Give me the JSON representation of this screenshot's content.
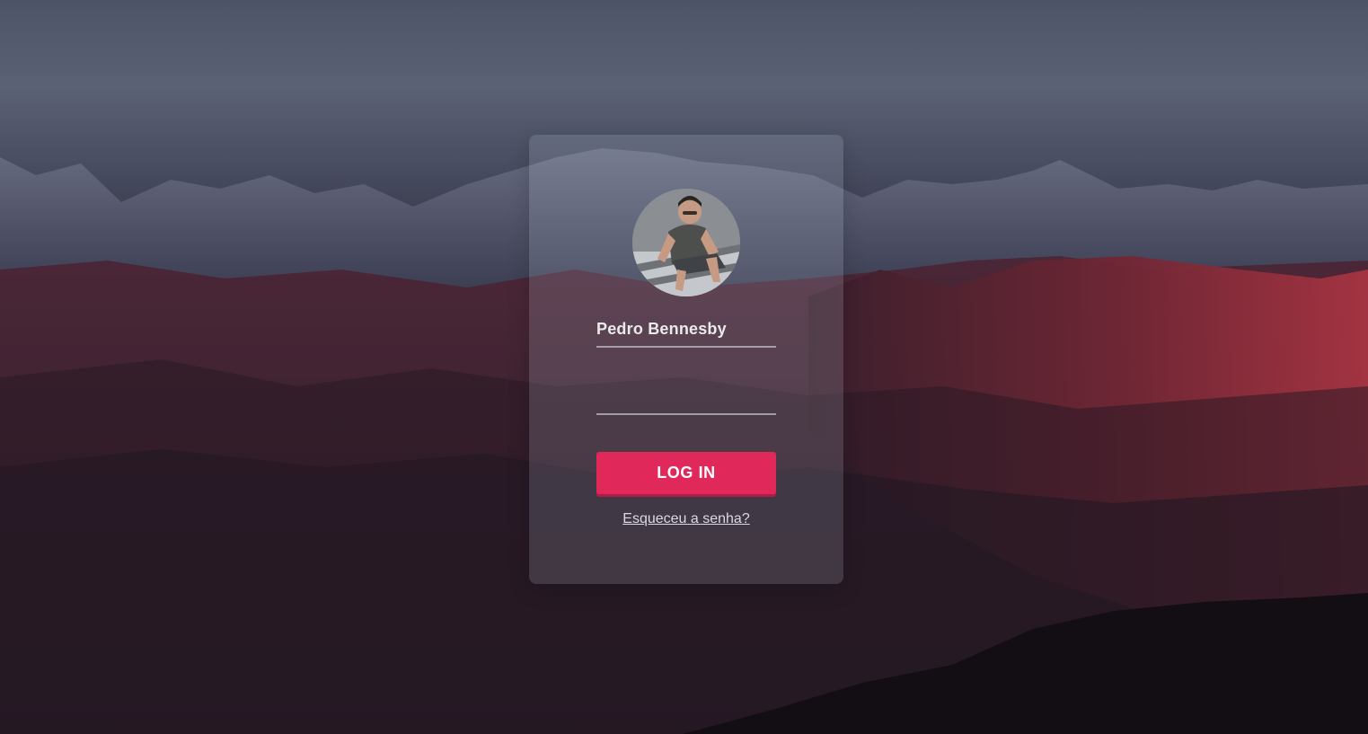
{
  "login": {
    "username": "Pedro Bennesby",
    "password_value": "",
    "button_label": "LOG IN",
    "forgot_link": "Esqueceu a senha?"
  },
  "colors": {
    "accent": "#e0285a",
    "card_bg": "rgba(190,198,214,0.18)"
  }
}
